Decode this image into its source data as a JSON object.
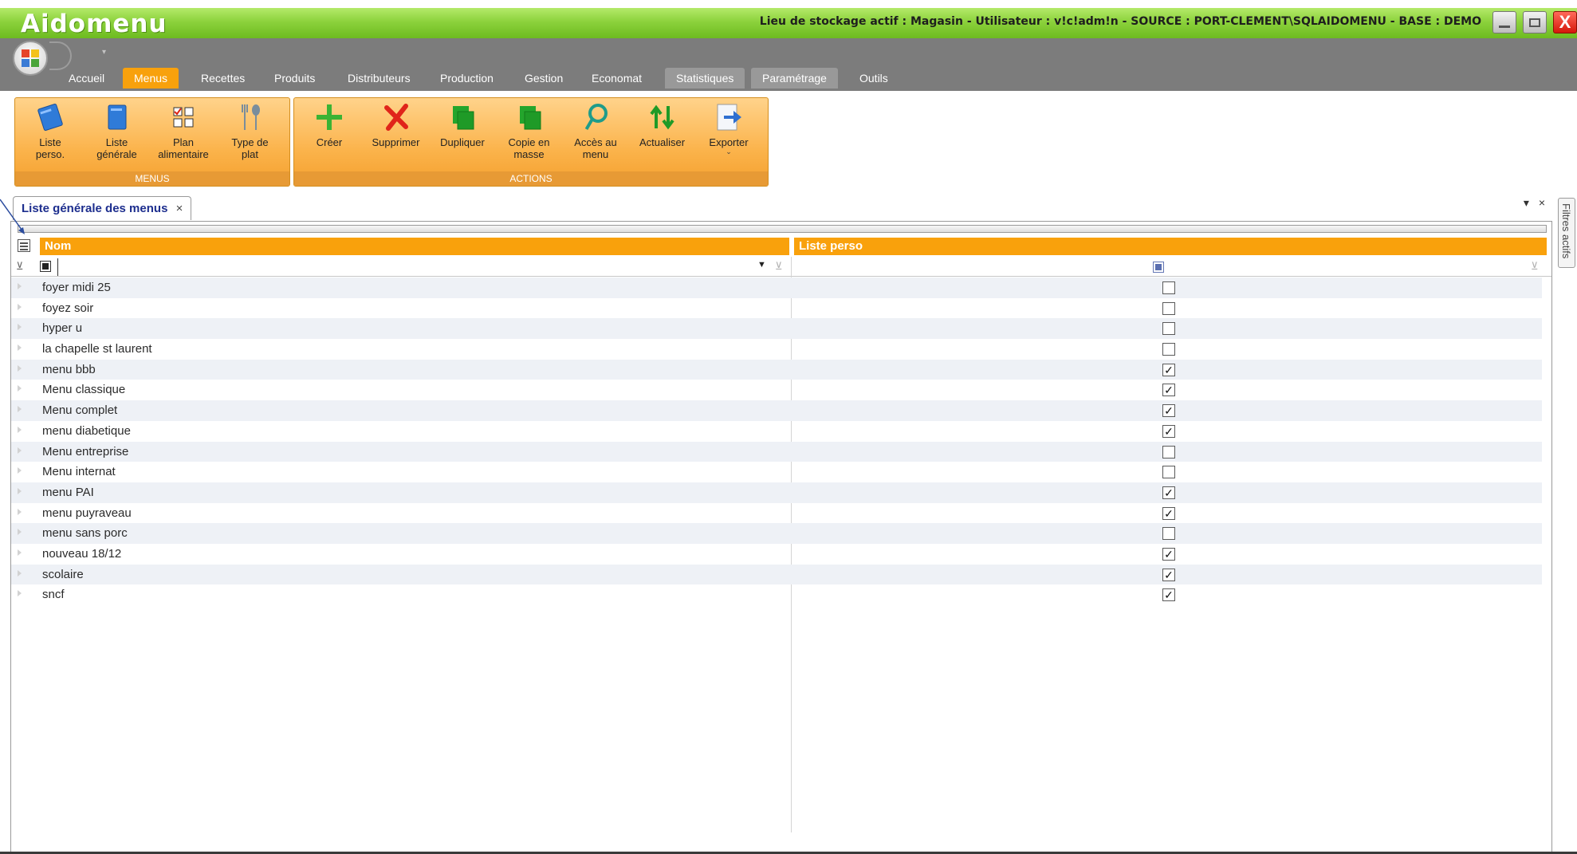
{
  "window": {
    "app_title": "Aidomenu",
    "status": "Lieu de stockage actif : Magasin - Utilisateur : v!c!adm!n - SOURCE : PORT-CLEMENT\\SQLAIDOMENU - BASE : DEMO",
    "close_glyph": "X"
  },
  "nav_tabs": [
    "Accueil",
    "Menus",
    "Recettes",
    "Produits",
    "Distributeurs",
    "Production",
    "Gestion",
    "Economat",
    "Statistiques",
    "Paramétrage",
    "Outils"
  ],
  "active_tab": "Menus",
  "highlighted_tabs": [
    "Statistiques",
    "Paramétrage"
  ],
  "ribbon": {
    "groups": [
      {
        "label": "MENUS",
        "buttons": [
          {
            "label": "Liste\nperso.",
            "icon": "notebook-blue-tilted-icon"
          },
          {
            "label": "Liste\ngénérale",
            "icon": "notebook-blue-icon"
          },
          {
            "label": "Plan\nalimentaire",
            "icon": "grid-plan-icon"
          },
          {
            "label": "Type de\nplat",
            "icon": "cutlery-icon"
          }
        ]
      },
      {
        "label": "ACTIONS",
        "buttons": [
          {
            "label": "Créer",
            "icon": "plus-icon"
          },
          {
            "label": "Supprimer",
            "icon": "delete-x-icon"
          },
          {
            "label": "Dupliquer",
            "icon": "duplicate-icon"
          },
          {
            "label": "Copie en\nmasse",
            "icon": "copy-mass-icon"
          },
          {
            "label": "Accès au\nmenu",
            "icon": "magnifier-icon"
          },
          {
            "label": "Actualiser",
            "icon": "refresh-arrows-icon"
          },
          {
            "label": "Exporter",
            "icon": "export-icon"
          }
        ]
      }
    ]
  },
  "document": {
    "tab_title": "Liste générale des menus",
    "tab_close": "×",
    "pane_controls": [
      "▾",
      "×"
    ],
    "side_panel": "Filtres actifs"
  },
  "grid": {
    "columns": [
      "Nom",
      "Liste perso"
    ],
    "filter_value": "",
    "rows": [
      {
        "name": "foyer midi 25",
        "perso": false
      },
      {
        "name": "foyez soir",
        "perso": false
      },
      {
        "name": "hyper u",
        "perso": false
      },
      {
        "name": "la chapelle st laurent",
        "perso": false
      },
      {
        "name": "menu bbb",
        "perso": true
      },
      {
        "name": "Menu classique",
        "perso": true
      },
      {
        "name": "Menu complet",
        "perso": true
      },
      {
        "name": "menu diabetique",
        "perso": true
      },
      {
        "name": "Menu entreprise",
        "perso": false
      },
      {
        "name": "Menu internat",
        "perso": false
      },
      {
        "name": "menu PAI",
        "perso": true
      },
      {
        "name": "menu puyraveau",
        "perso": true
      },
      {
        "name": "menu sans porc",
        "perso": false
      },
      {
        "name": "nouveau 18/12",
        "perso": true
      },
      {
        "name": "scolaire",
        "perso": true
      },
      {
        "name": "sncf",
        "perso": true
      }
    ]
  },
  "colors": {
    "title_green": "#8cd23c",
    "accent_orange": "#f8a10c",
    "row_alt": "#eef1f6"
  }
}
